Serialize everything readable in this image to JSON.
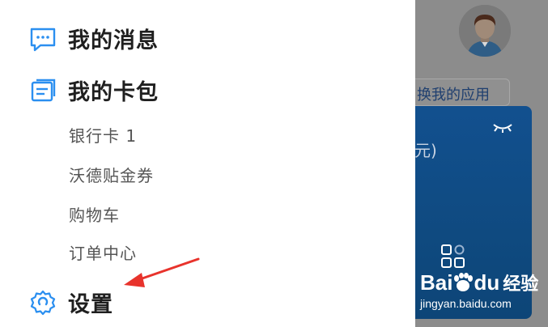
{
  "menu": {
    "messages_label": "我的消息",
    "wallet_label": "我的卡包",
    "wallet_items": [
      "银行卡 1",
      "沃德贴金券",
      "购物车",
      "订单中心"
    ],
    "settings_label": "设置"
  },
  "background": {
    "switch_apps_label": "换我的应用",
    "card_text": "元)"
  },
  "watermark": {
    "brand_prefix": "Bai",
    "brand_suffix": "du",
    "brand_product": "经验",
    "url": "jingyan.baidu.com"
  },
  "colors": {
    "icon_blue": "#2b8ff0",
    "text_dark": "#1f1f1f",
    "text_sub": "#555555",
    "overlay_gray": "#8c8c8c",
    "card_blue": "#12508f",
    "arrow_red": "#e8332c"
  },
  "icons": {
    "messages": "chat-bubble-icon",
    "wallet": "card-wallet-icon",
    "settings": "gear-icon"
  }
}
